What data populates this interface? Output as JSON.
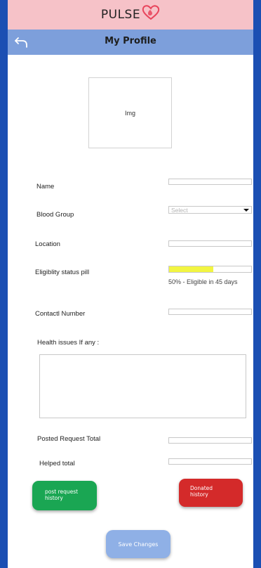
{
  "brand": {
    "name": "PULSE",
    "logo_icon": "heart-droplet-icon",
    "bar_color": "#f6c2c8"
  },
  "header": {
    "title": "My Profile",
    "back_icon": "back-arrow-icon",
    "bar_color": "#7d9fdb"
  },
  "avatar": {
    "placeholder_text": "Img"
  },
  "form": {
    "name_label": "Name",
    "name_value": "",
    "blood_group_label": "Blood Group",
    "blood_group_placeholder": "Select",
    "location_label": "Location",
    "location_value": "",
    "eligibility_label": "Eligiblity status pill",
    "eligibility_fill_percent": 54,
    "eligibility_text": "50% - Eligible in 45 days",
    "contact_label": "Contactl Number",
    "contact_value": "",
    "health_label": "Health issues If any :",
    "health_value": ""
  },
  "stats": {
    "posted_label": "Posted Request Total",
    "posted_value": "",
    "helped_label": "Helped total",
    "helped_value": ""
  },
  "buttons": {
    "post_history": "post request history",
    "donated_history": "Donated history",
    "save": "Save Changes"
  },
  "colors": {
    "frame": "#1b4fb3",
    "pill_fill": "#f2f542",
    "post_button": "#1aa653",
    "donated_button": "#d42a2a",
    "save_button": "#8fb0e6"
  }
}
